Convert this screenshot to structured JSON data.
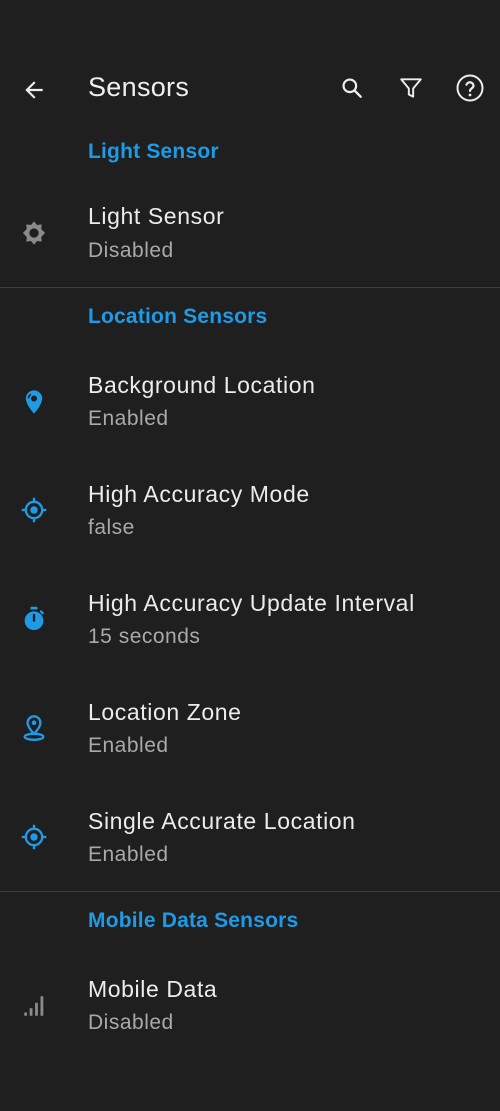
{
  "header": {
    "title": "Sensors",
    "icons": [
      "arrow-left-icon",
      "search-icon",
      "filter-icon",
      "help-circle-icon"
    ]
  },
  "sections": [
    {
      "title": "Light Sensor",
      "items": [
        {
          "label": "Light Sensor",
          "value": "Disabled",
          "icon": "brightness-icon",
          "icon_color": "#8a8a8a"
        }
      ]
    },
    {
      "title": "Location Sensors",
      "items": [
        {
          "label": "Background Location",
          "value": "Enabled",
          "icon": "map-marker-radius-icon",
          "icon_color": "#1e9be6"
        },
        {
          "label": "High Accuracy Mode",
          "value": "false",
          "icon": "crosshairs-gps-icon",
          "icon_color": "#1e9be6"
        },
        {
          "label": "High Accuracy Update Interval",
          "value": "15 seconds",
          "icon": "timer-icon",
          "icon_color": "#1e9be6"
        },
        {
          "label": "Location Zone",
          "value": "Enabled",
          "icon": "map-marker-zone-icon",
          "icon_color": "#1e9be6"
        },
        {
          "label": "Single Accurate Location",
          "value": "Enabled",
          "icon": "crosshairs-gps-icon",
          "icon_color": "#1e9be6"
        }
      ]
    },
    {
      "title": "Mobile Data Sensors",
      "items": [
        {
          "label": "Mobile Data",
          "value": "Disabled",
          "icon": "signal-cellular-icon",
          "icon_color": "#8a8a8a"
        }
      ]
    }
  ],
  "colors": {
    "background": "#1f1f1f",
    "accent": "#1e9be6",
    "text_primary": "#ececec",
    "text_secondary": "#a9a9a9",
    "divider": "#3d3d3d"
  }
}
